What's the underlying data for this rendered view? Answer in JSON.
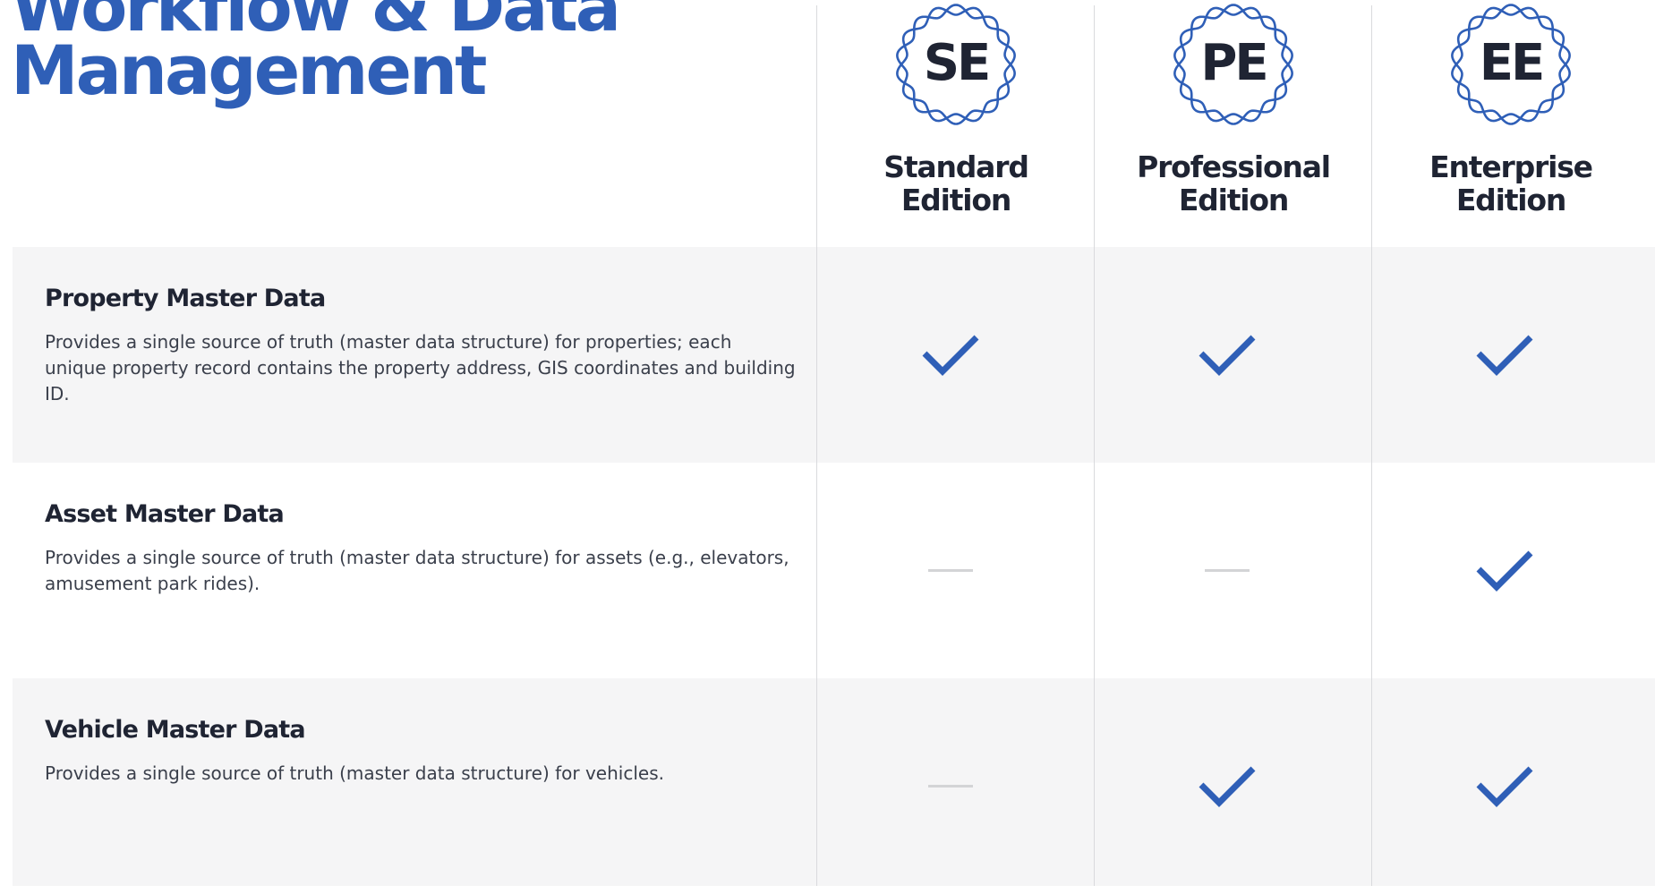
{
  "title": {
    "line1": "Workflow & Data",
    "line2": "Management"
  },
  "colors": {
    "accent": "#2f5fb7",
    "text": "#1f2433",
    "row_shade": "#f5f5f6",
    "divider": "#d9dadd",
    "dash": "#d3d4d6"
  },
  "editions": [
    {
      "abbr": "SE",
      "name_line1": "Standard",
      "name_line2": "Edition",
      "icon": "wavy-seal-badge-icon"
    },
    {
      "abbr": "PE",
      "name_line1": "Professional",
      "name_line2": "Edition",
      "icon": "wavy-seal-badge-icon"
    },
    {
      "abbr": "EE",
      "name_line1": "Enterprise",
      "name_line2": "Edition",
      "icon": "wavy-seal-badge-icon"
    }
  ],
  "features": [
    {
      "name": "Property Master Data",
      "description": "Provides a single source of truth (master data structure) for properties; each unique property record contains the property address, GIS coordinates and building ID.",
      "availability": [
        true,
        true,
        true
      ]
    },
    {
      "name": "Asset Master Data",
      "description": "Provides a single source of truth (master data structure) for assets (e.g., elevators, amusement park rides).",
      "availability": [
        false,
        false,
        true
      ]
    },
    {
      "name": "Vehicle Master Data",
      "description": "Provides a single source of truth (master data structure) for vehicles.",
      "availability": [
        false,
        true,
        true
      ]
    }
  ],
  "icons": {
    "included": "checkmark-icon",
    "not_included": "dash-icon"
  }
}
